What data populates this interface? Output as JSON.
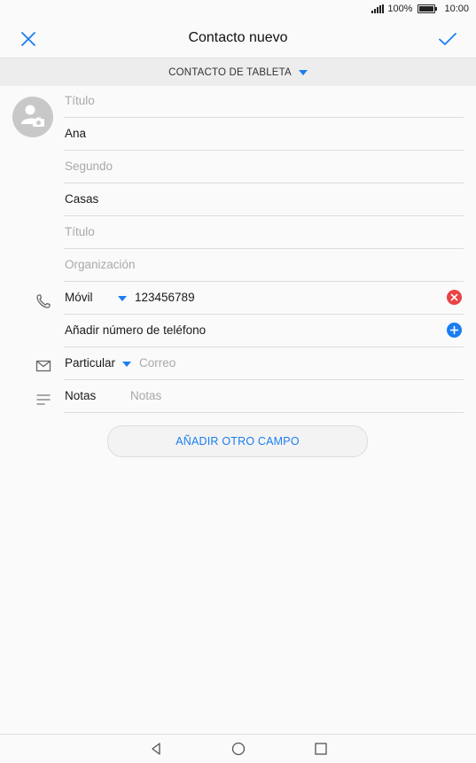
{
  "status": {
    "battery": "100%",
    "time": "10:00",
    "battery_level": 1.0
  },
  "header": {
    "title": "Contacto nuevo"
  },
  "account": {
    "label": "CONTACTO DE TABLETA"
  },
  "fields": {
    "prefix_placeholder": "Título",
    "first_name": "Ana",
    "middle_placeholder": "Segundo",
    "last_name": "Casas",
    "job_title_placeholder": "Título",
    "organization_placeholder": "Organización"
  },
  "phone": {
    "type": "Móvil",
    "number": "123456789",
    "add_label": "Añadir número de teléfono"
  },
  "email": {
    "type": "Particular",
    "placeholder": "Correo"
  },
  "notes": {
    "label": "Notas",
    "placeholder": "Notas"
  },
  "actions": {
    "add_field": "AÑADIR OTRO CAMPO"
  },
  "colors": {
    "accent": "#1a7ef0",
    "remove": "#e84444",
    "avatar": "#c8c8c8"
  }
}
